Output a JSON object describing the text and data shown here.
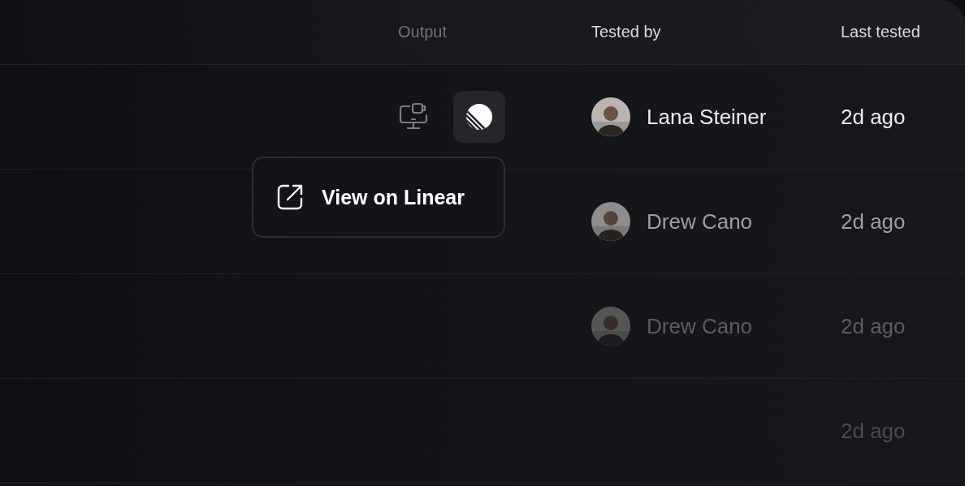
{
  "table": {
    "columns": [
      "Output",
      "Tested by",
      "Last tested"
    ],
    "rows": [
      {
        "output": [
          {
            "kind": "monitor"
          },
          {
            "kind": "linear",
            "active": true
          }
        ],
        "tested_by": {
          "name": "Lana Steiner"
        },
        "last_tested": "2d ago"
      },
      {
        "tested_by": {
          "name": "Drew Cano"
        },
        "last_tested": "2d ago"
      },
      {
        "tested_by": {
          "name": "Drew Cano"
        },
        "last_tested": "2d ago"
      },
      {
        "last_tested": "2d ago"
      }
    ]
  },
  "menu": {
    "items": [
      {
        "label": "View on Linear"
      }
    ]
  }
}
